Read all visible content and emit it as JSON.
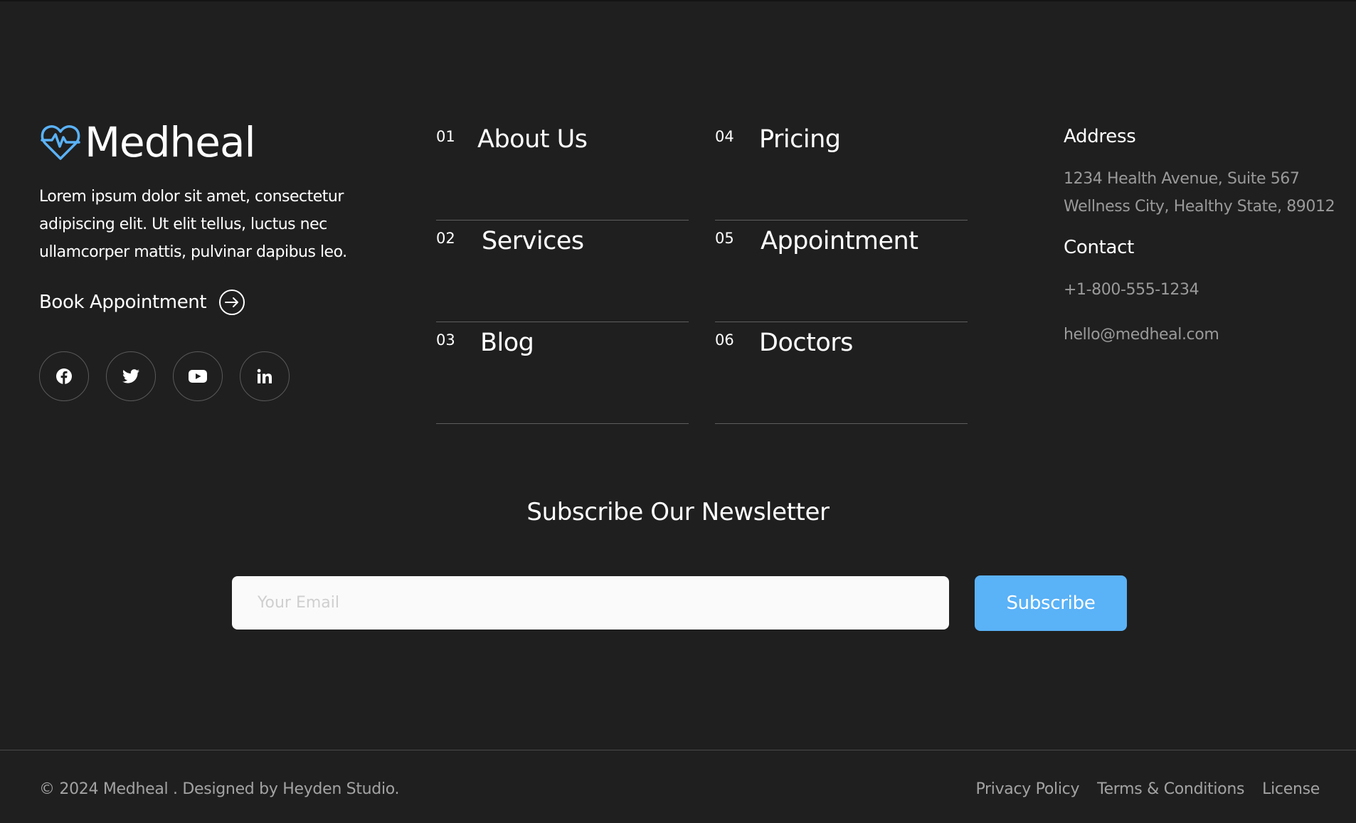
{
  "brand": {
    "name": "Medheal",
    "logo_icon": "heartbeat-icon",
    "accent_color": "#5ab2f7",
    "description": "Lorem ipsum dolor sit amet, consectetur adipiscing elit. Ut elit tellus, luctus nec ullamcorper mattis, pulvinar dapibus leo.",
    "book_label": "Book Appointment",
    "book_icon": "arrow-right-circle-icon",
    "socials": [
      {
        "name": "facebook",
        "icon": "facebook-icon"
      },
      {
        "name": "twitter",
        "icon": "twitter-icon"
      },
      {
        "name": "youtube",
        "icon": "youtube-icon"
      },
      {
        "name": "linkedin",
        "icon": "linkedin-icon"
      }
    ]
  },
  "nav": {
    "left": [
      {
        "num": "01",
        "label": "About Us"
      },
      {
        "num": "02",
        "label": "Services"
      },
      {
        "num": "03",
        "label": "Blog"
      }
    ],
    "right": [
      {
        "num": "04",
        "label": "Pricing"
      },
      {
        "num": "05",
        "label": "Appointment"
      },
      {
        "num": "06",
        "label": "Doctors"
      }
    ]
  },
  "contact": {
    "address_heading": "Address",
    "address_line1": "1234 Health Avenue, Suite 567",
    "address_line2": "Wellness City, Healthy State, 89012",
    "contact_heading": "Contact",
    "phone": "+1-800-555-1234",
    "email": "hello@medheal.com"
  },
  "newsletter": {
    "title": "Subscribe Our Newsletter",
    "placeholder": "Your Email",
    "button_label": "Subscribe",
    "button_color": "#5ab2f7"
  },
  "footer": {
    "copyright": "© 2024 Medheal . Designed by Heyden Studio.",
    "links": [
      "Privacy Policy",
      "Terms & Conditions",
      "License"
    ]
  }
}
